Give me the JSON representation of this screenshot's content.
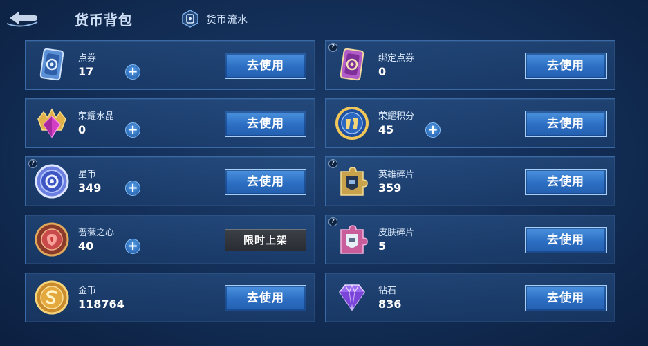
{
  "header": {
    "title": "货币背包",
    "flow_link": "货币流水"
  },
  "currencies": [
    {
      "name": "点券",
      "amount": "17",
      "button": "去使用"
    },
    {
      "name": "绑定点券",
      "amount": "0",
      "button": "去使用"
    },
    {
      "name": "荣耀水晶",
      "amount": "0",
      "button": "去使用"
    },
    {
      "name": "荣耀积分",
      "amount": "45",
      "button": "去使用"
    },
    {
      "name": "星币",
      "amount": "349",
      "button": "去使用"
    },
    {
      "name": "英雄碎片",
      "amount": "359",
      "button": "去使用"
    },
    {
      "name": "蔷薇之心",
      "amount": "40",
      "button": "限时上架"
    },
    {
      "name": "皮肤碎片",
      "amount": "5",
      "button": "去使用"
    },
    {
      "name": "金币",
      "amount": "118764",
      "button": "去使用"
    },
    {
      "name": "钻石",
      "amount": "836",
      "button": "去使用"
    }
  ],
  "icons": {
    "back": "back-arrow-icon",
    "flow": "currency-flow-icon",
    "plus": "plus-icon",
    "help": "question-mark-icon"
  },
  "colors": {
    "use_button": "#2f73c8",
    "limited_button": "#31343a",
    "card_border": "#3a6aa6"
  }
}
